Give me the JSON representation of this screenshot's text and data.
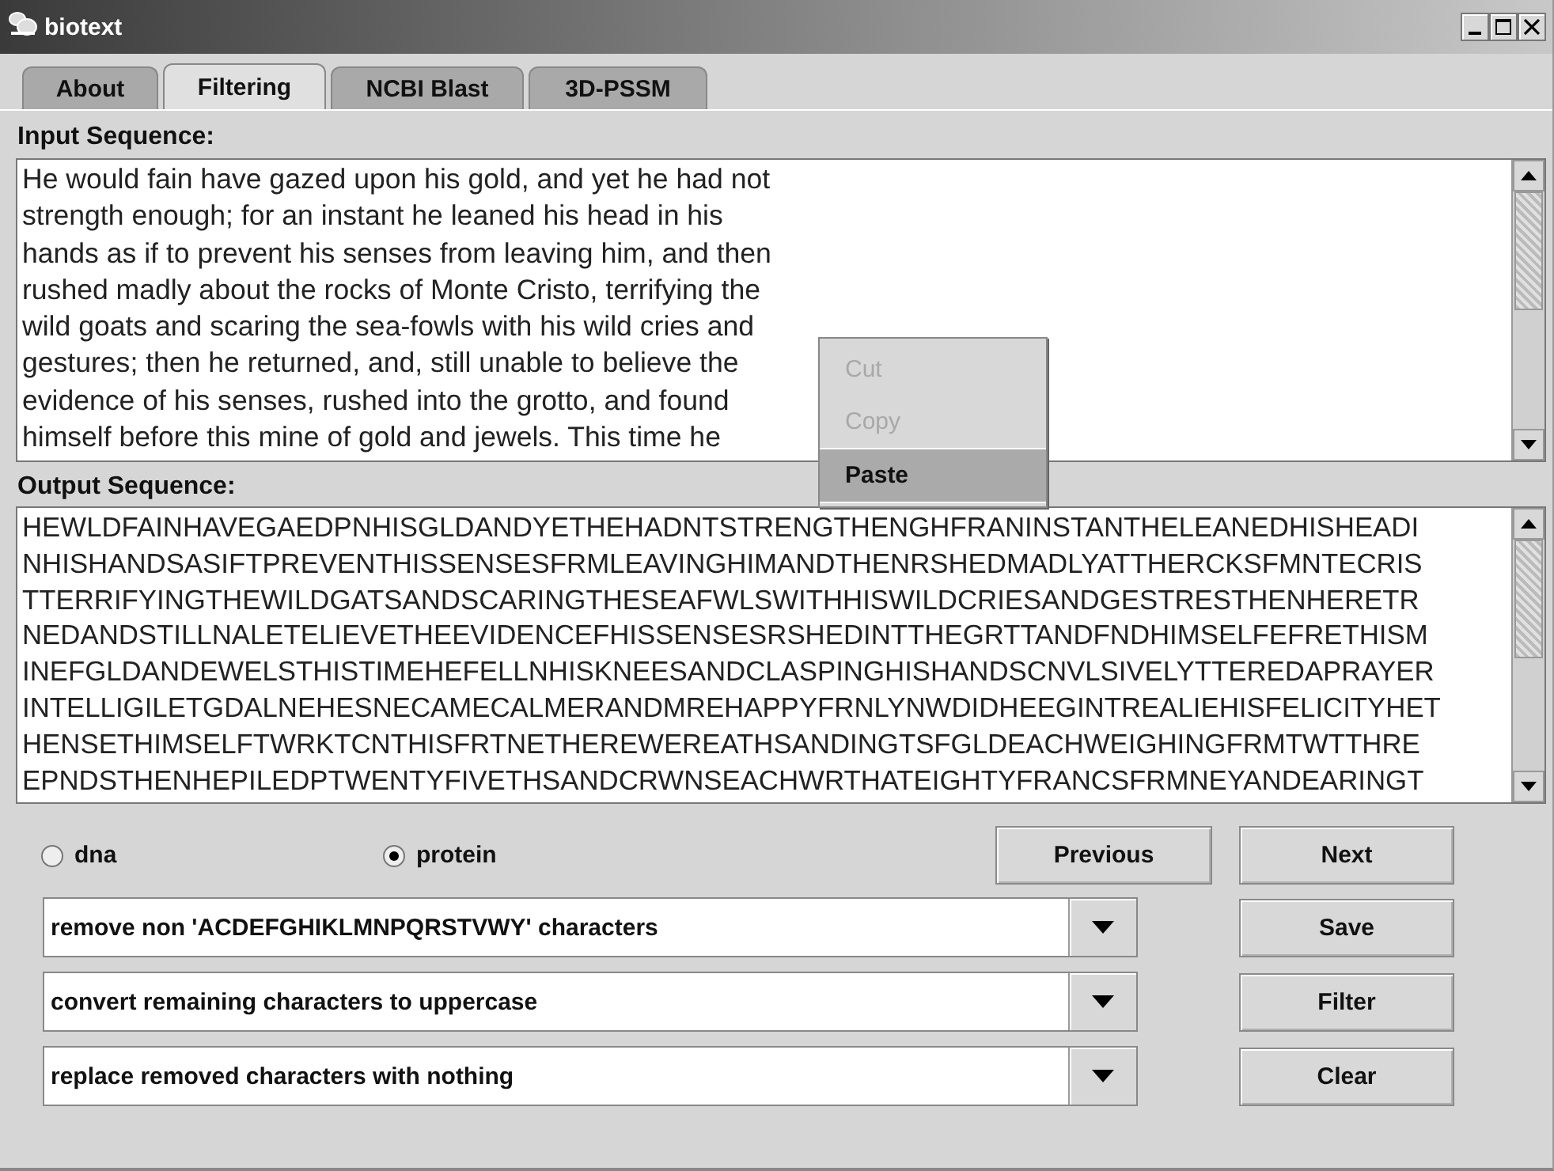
{
  "window": {
    "title": "biotext"
  },
  "tabs": [
    {
      "label": "About",
      "selected": false
    },
    {
      "label": "Filtering",
      "selected": true
    },
    {
      "label": "NCBI Blast",
      "selected": false
    },
    {
      "label": "3D-PSSM",
      "selected": false
    }
  ],
  "input_sequence": {
    "label": "Input Sequence:",
    "lines": [
      "He would fain have gazed upon his gold, and yet he had not",
      "strength enough; for an instant he leaned his head in his",
      "hands as if to prevent his senses from leaving him, and then",
      "rushed madly about the rocks of Monte Cristo, terrifying the",
      "wild goats and scaring the sea-fowls with his wild cries and",
      "gestures; then he returned, and, still unable to believe the",
      "evidence of his senses, rushed into the grotto, and found",
      "himself before this mine of gold and jewels. This time he"
    ]
  },
  "context_menu": {
    "items": [
      {
        "label": "Cut",
        "disabled": true,
        "selected": false
      },
      {
        "label": "Copy",
        "disabled": true,
        "selected": false
      },
      {
        "label": "Paste",
        "disabled": false,
        "selected": true
      }
    ]
  },
  "output_sequence": {
    "label": "Output Sequence:",
    "lines": [
      "HEWLDFAINHAVEGAEDPNHISGLDANDYETHEHADNTSTRENGTHENGHFRANINSTANTHELEANEDHISHEADI",
      "NHISHANDSASIFTPREVENTHISSENSESFRMLEAVINGHIMANDTHENRSHEDMADLYATTHERCKSFMNTECRIS",
      "TTERRIFYINGTHEWILDGATSANDSCARINGTHESEAFWLSWITHHISWILDCRIESANDGESTRESTHENHERETR",
      "NEDANDSTILLNALETELIEVETHEEVIDENCEFHISSENSESRSHEDINTTHEGRTTANDFNDHIMSELFEFRETHISM",
      "INEFGLDANDEWELSTHISTIMEHEFELLNHISKNEESANDCLASPINGHISHANDSCNVLSIVELYTTEREDAPRAYER",
      "INTELLIGILETGDALNEHESNECAMECALMERANDMREHAPPYFRNLYNWDIDHEEGINTREALIEHISFELICITYHET",
      "HENSETHIMSELFTWRKTCNTHISFRTNETHEREWEREATHSANDINGTSFGLDEACHWEIGHINGFRMTWTTHRE",
      "EPNDSTHENHEPILEDPTWENTYFIVETHSANDCRWNSEACHWRTHATEIGHTYFRANCSFRMNEYANDEARINGT"
    ]
  },
  "sequence_type": [
    {
      "label": "dna",
      "selected": false
    },
    {
      "label": "protein",
      "selected": true
    }
  ],
  "filters": [
    {
      "value": "remove non 'ACDEFGHIKLMNPQRSTVWY' characters"
    },
    {
      "value": "convert remaining characters to uppercase"
    },
    {
      "value": "replace removed characters with nothing"
    }
  ],
  "buttons": [
    "Previous",
    "Next",
    "Save",
    "Filter",
    "Clear"
  ]
}
